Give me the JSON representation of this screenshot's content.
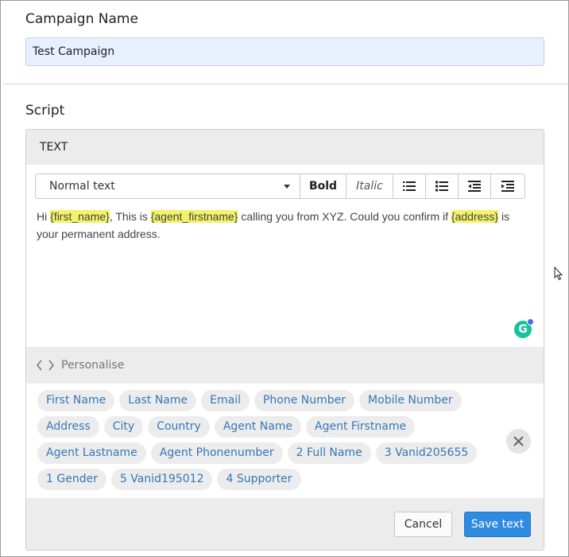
{
  "campaign": {
    "heading": "Campaign Name",
    "value": "Test Campaign"
  },
  "script": {
    "heading": "Script",
    "panel_title": "TEXT",
    "toolbar": {
      "format_select": "Normal text",
      "bold": "Bold",
      "italic": "Italic",
      "icons": [
        "unordered-list-icon",
        "ordered-list-icon",
        "outdent-icon",
        "indent-icon"
      ]
    },
    "editor": {
      "seg1": "Hi ",
      "tok1": "{first_name}",
      "seg2": ", This is ",
      "tok2": "{agent_firstname}",
      "seg3": " calling you from XYZ. Could you confirm if ",
      "tok3": "{address}",
      "seg4": " is your permanent address."
    }
  },
  "personalise": {
    "label": "Personalise",
    "tags": [
      [
        "First Name",
        "Last Name",
        "Email",
        "Phone Number",
        "Mobile Number"
      ],
      [
        "Address",
        "City",
        "Country",
        "Agent Name",
        "Agent Firstname"
      ],
      [
        "Agent Lastname",
        "Agent Phonenumber",
        "2 Full Name",
        "3 Vanid205655"
      ],
      [
        "1 Gender",
        "5 Vanid195012",
        "4 Supporter"
      ]
    ]
  },
  "footer": {
    "cancel": "Cancel",
    "save": "Save text"
  },
  "colors": {
    "accent": "#2e8be0",
    "tag_text": "#3478b7",
    "highlight": "#f3f36a",
    "input_bg": "#e8f0fe",
    "grammarly": "#15c39a"
  }
}
